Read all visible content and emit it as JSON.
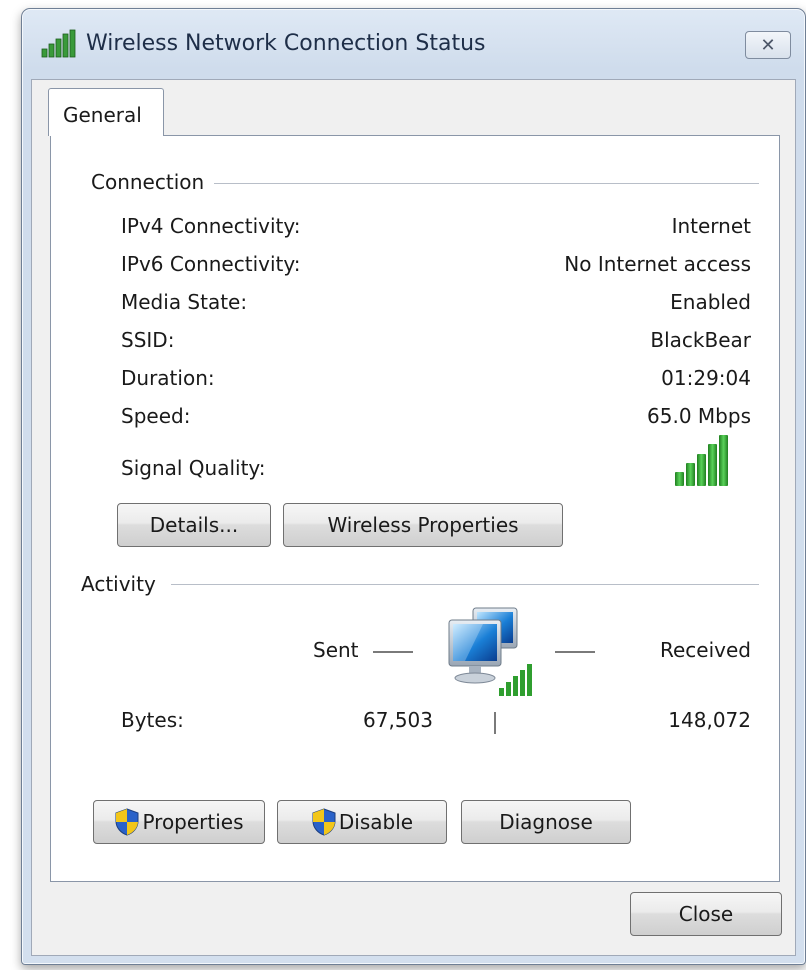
{
  "window": {
    "title": "Wireless Network Connection Status",
    "close_glyph": "✕"
  },
  "tabs": [
    {
      "label": "General",
      "selected": true
    }
  ],
  "connection": {
    "section_label": "Connection",
    "rows": [
      {
        "label": "IPv4 Connectivity:",
        "value": "Internet"
      },
      {
        "label": "IPv6 Connectivity:",
        "value": "No Internet access"
      },
      {
        "label": "Media State:",
        "value": "Enabled"
      },
      {
        "label": "SSID:",
        "value": "BlackBear"
      },
      {
        "label": "Duration:",
        "value": "01:29:04"
      },
      {
        "label": "Speed:",
        "value": "65.0 Mbps"
      }
    ],
    "signal_label": "Signal Quality:",
    "signal_bars": 5,
    "details_button": "Details...",
    "wireless_properties_button": "Wireless Properties"
  },
  "activity": {
    "section_label": "Activity",
    "sent_label": "Sent",
    "received_label": "Received",
    "bytes_label": "Bytes:",
    "bytes_sent": "67,503",
    "bytes_received": "148,072"
  },
  "buttons": {
    "properties": "Properties",
    "disable": "Disable",
    "diagnose": "Diagnose",
    "close": "Close"
  },
  "icons": {
    "title": "wireless-signal-icon",
    "signal": "signal-strength-icon",
    "network": "network-computers-icon",
    "shield": "uac-shield-icon"
  },
  "colors": {
    "signal_green": "#2f9e2f",
    "frame": "#cfdcec"
  }
}
